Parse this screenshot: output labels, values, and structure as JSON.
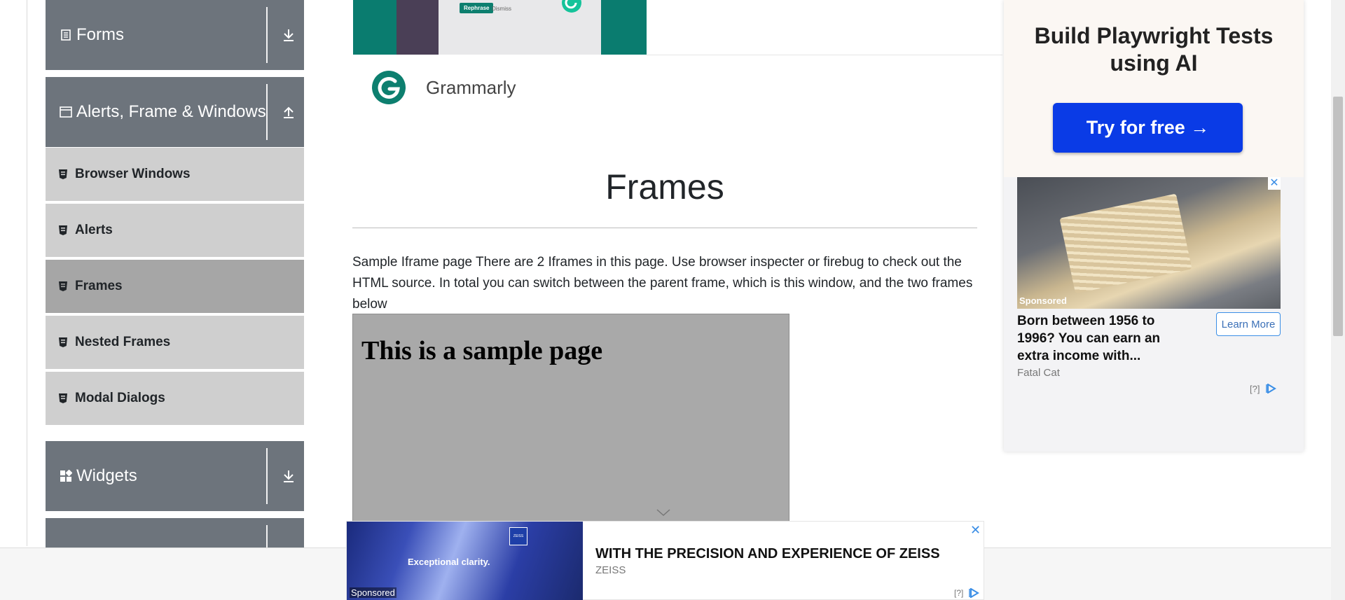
{
  "sidebar": {
    "groups": [
      {
        "label": "Forms",
        "icon": "document-icon"
      },
      {
        "label": "Alerts, Frame & Windows",
        "icon": "window-icon"
      },
      {
        "label": "Widgets",
        "icon": "grid-icon"
      }
    ],
    "items": [
      {
        "label": "Browser Windows",
        "active": false
      },
      {
        "label": "Alerts",
        "active": false
      },
      {
        "label": "Frames",
        "active": true
      },
      {
        "label": "Nested Frames",
        "active": false
      },
      {
        "label": "Modal Dialogs",
        "active": false
      }
    ]
  },
  "top_banner": {
    "rephrase_label": "Rephrase",
    "dismiss_label": "Dismiss"
  },
  "grammarly": {
    "name": "Grammarly"
  },
  "main": {
    "title": "Frames",
    "description": "Sample Iframe page There are 2 Iframes in this page. Use browser inspecter or firebug to check out the HTML source. In total you can switch between the parent frame, which is this window, and the two frames below",
    "iframe_heading": "This is a sample page"
  },
  "right_ad": {
    "headline": "Build Playwright Tests using AI",
    "cta": "Try for free →",
    "close": "✕",
    "sponsored": "Sponsored",
    "text": "Born between 1956 to 1996? You can earn an extra income with...",
    "learn_more": "Learn More",
    "brand": "Fatal Cat",
    "q": "[?]"
  },
  "bottom_ad": {
    "image_title": "Exceptional clarity.",
    "sponsored": "Sponsored",
    "headline": "WITH THE PRECISION AND EXPERIENCE OF ZEISS",
    "brand": "ZEISS",
    "close": "✕",
    "q": "[?]",
    "logo_text": "ZEISS"
  },
  "colors": {
    "sidebar_header": "#6d747c",
    "sidebar_item": "#cfcfcf",
    "sidebar_item_active": "#a6a6a6",
    "cta_blue": "#0a3be6",
    "grammarly_green": "#0a7c6f"
  }
}
